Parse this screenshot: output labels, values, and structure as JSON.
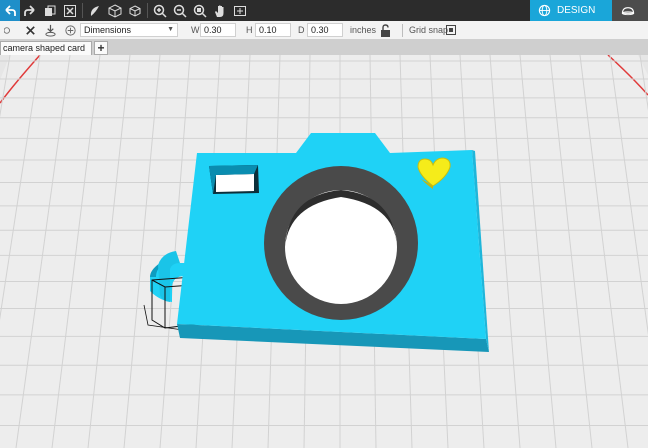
{
  "toolbar": {
    "buttons": [
      {
        "name": "undo-icon",
        "active": true
      },
      {
        "name": "redo-icon",
        "active": false
      },
      {
        "name": "copy-icon",
        "active": false
      },
      {
        "name": "delete-icon",
        "active": false
      },
      {
        "name": "shapes-icon",
        "active": false
      },
      {
        "name": "perspective-icon",
        "active": false
      },
      {
        "name": "orthographic-icon",
        "active": false
      },
      {
        "name": "zoom-in-icon",
        "active": false
      },
      {
        "name": "zoom-out-icon",
        "active": false
      },
      {
        "name": "zoom-fit-icon",
        "active": false
      },
      {
        "name": "pan-hand-icon",
        "active": false
      },
      {
        "name": "frame-icon",
        "active": false
      }
    ],
    "design_label": "DESIGN",
    "colors": {
      "toolbar_bg": "#2c2c2c",
      "active": "#1f8fc9",
      "design_tab": "#1aa6d9"
    }
  },
  "properties": {
    "dropdown_value": "Dimensions",
    "w_label": "W",
    "w_value": "0.30",
    "h_label": "H",
    "h_value": "0.10",
    "d_label": "D",
    "d_value": "0.30",
    "units": "inches",
    "grid_snap_label": "Grid snap"
  },
  "tabs": {
    "document_name": "camera shaped card",
    "add_label": "+"
  },
  "scene": {
    "body_color": "#1fd2f6",
    "ring_color": "#4a4a4a",
    "heart_color": "#f5ec1a",
    "selection_outline": "#111111",
    "grid_color": "#d4d4d4"
  }
}
